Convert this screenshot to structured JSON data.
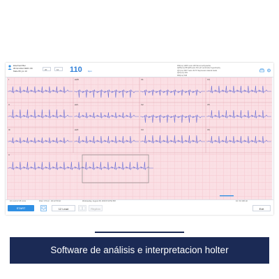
{
  "patient": {
    "name": "Eberhard Bai",
    "line2": "05.02.2012 MRN: 80",
    "line3": "Male 80 yrs 10"
  },
  "toolbar": {
    "select1": "20",
    "select2": "10",
    "heart_rate": "110",
    "heart_rate_unit": "bpm"
  },
  "info_panel": [
    "PR(ms)  138   P-axis  118   Sinus tachycardia",
    "QRS(ms)  88   QRS-axis  63   Left ventricular hypertrophy",
    "QT(ms)  300   T-axis   49   ST depression lateral leads",
    "QTc(ms)  404",
    "RR(ms)  548"
  ],
  "leads": [
    "I",
    "aVR",
    "V1",
    "V4",
    "II",
    "aVL",
    "V2",
    "V5",
    "III",
    "aVF",
    "V3",
    "V6",
    "II"
  ],
  "status_bar": {
    "left": "10 mm/mV   25 mm/s",
    "filter": "Filter: 0.5 Hz - 40 Hz   50 Hz",
    "date": "Wednesday, August 28, 2019 8:10:54 PM",
    "right": "10 / 10  100 Hz"
  },
  "bottom": {
    "start_label": "START",
    "lead_select": "12 Lead",
    "rhythm_label": "Rhythm",
    "exit_label": "Exit"
  },
  "caption": "Software de análisis e interpretacion holter",
  "colors": {
    "accent": "#2f8fe3",
    "trace": "#6b6fd6",
    "grid_bg": "#fbe6ea",
    "banner": "#1b2a55"
  }
}
